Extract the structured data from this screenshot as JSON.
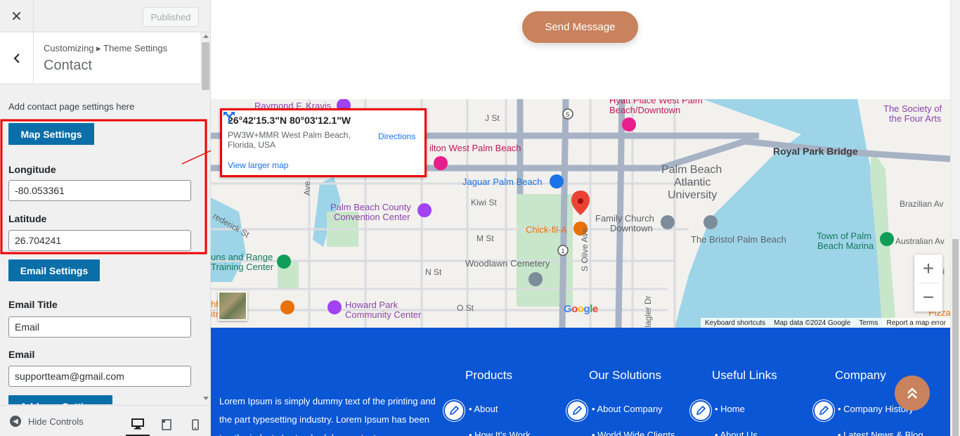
{
  "topbar": {
    "close_glyph": "✕",
    "published_label": "Published"
  },
  "section": {
    "breadcrumb": "Customizing ▸ Theme Settings",
    "title": "Contact"
  },
  "panel": {
    "description": "Add contact page settings here",
    "map_settings_label": "Map Settings",
    "longitude_label": "Longitude",
    "longitude_value": "-80.053361",
    "latitude_label": "Latitude",
    "latitude_value": "26.704241",
    "email_settings_label": "Email Settings",
    "email_title_label": "Email Title",
    "email_title_value": "Email",
    "email_label": "Email",
    "email_value": "supportteam@gmail.com",
    "address_settings_label": "Address Settings"
  },
  "bottom": {
    "hide_controls_label": "Hide Controls"
  },
  "preview": {
    "send_message_label": "Send Message"
  },
  "map": {
    "coords": "26°42'15.3\"N 80°03'12.1\"W",
    "address": "PW3W+MMR West Palm Beach, Florida, USA",
    "view_larger": "View larger map",
    "directions": "Directions",
    "labels": {
      "raymond": "Raymond F. Kravis",
      "hyatt": "Hyatt Place West Palm",
      "hyatt2": "Beach/Downtown",
      "society": "The Society of",
      "society2": "the Four Arts",
      "jst": "J St",
      "hilton": "ilton West Palm Beach",
      "royal": "Royal Park Bridge",
      "pba": "Palm Beach",
      "pba2": "Atlantic",
      "pba3": "University",
      "jaguar": "Jaguar Palm Beach",
      "kiwi": "Kiwi St",
      "convention": "Palm Beach County",
      "convention2": "Convention Center",
      "frederick": "rederick St",
      "chick": "Chick-fil-A",
      "family": "Family Church",
      "family2": "Downtown",
      "bristol": "The Bristol Palm Beach",
      "mst": "M St",
      "town": "Town of Palm",
      "town2": "Beach Marina",
      "brazilian": "Brazilian Av",
      "australian": "Australian Av",
      "guns": "uns and Range",
      "guns2": "Training Center",
      "nst": "N St",
      "woodlawn": "Woodlawn Cemetery",
      "chi": "Chi",
      "playhouse": "hhouse",
      "playhouse2": "itorium",
      "howard": "Howard Park",
      "howard2": "Community Center",
      "ost": "O St",
      "olive": "S Olive Ave",
      "flagler": "Flagler Dr",
      "pizza": "Pizza",
      "ave": "Ave",
      "route5": "5",
      "route1": "1"
    },
    "google": {
      "g1": "G",
      "o1": "o",
      "o2": "o",
      "g2": "g",
      "l": "l",
      "e": "e"
    },
    "attribution": [
      "Keyboard shortcuts",
      "Map data ©2024 Google",
      "Terms",
      "Report a map error"
    ]
  },
  "footer": {
    "text": "Lorem Ipsum is simply dummy text of the printing and the part typesetting industry. Lorem Ipsum has been tee the industry's standard dummy text ever",
    "cols": [
      {
        "title": "Products",
        "items": [
          "About",
          "How It's Work"
        ]
      },
      {
        "title": "Our Solutions",
        "items": [
          "About Company",
          "World Wide Clients"
        ]
      },
      {
        "title": "Useful Links",
        "items": [
          "Home",
          "About Us"
        ]
      },
      {
        "title": "Company",
        "items": [
          "Company History",
          "Latest News & Blog"
        ]
      }
    ]
  }
}
